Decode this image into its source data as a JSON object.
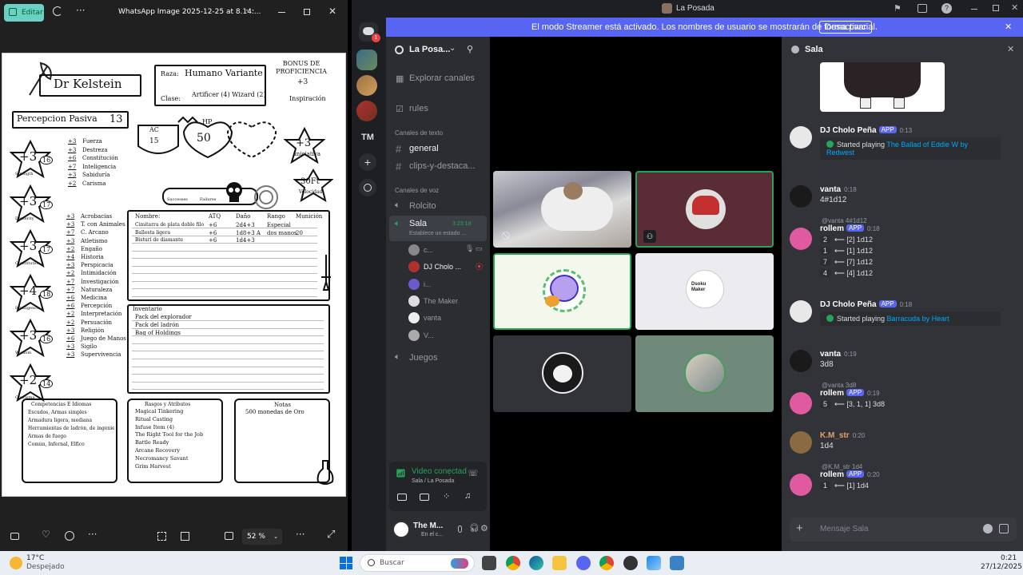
{
  "viewer": {
    "edit_label": "Editar",
    "filename": "WhatsApp Image 2025-12-25 at 8.14....",
    "zoom": "52 %",
    "sheet": {
      "name": "Dr Kelstein",
      "race_label": "Raza:",
      "race": "Humano Variante",
      "class_label": "Clase:",
      "class": "Artificer (4) Wizard (2)",
      "bonus_title": "BONUS DE PROFICIENCIA",
      "bonus": "+3",
      "inspiration": "Inspiración",
      "passive": "Percepcion Pasiva",
      "passive_val": "13",
      "ac_label": "AC",
      "ac": "15",
      "hp_label": "HP",
      "hp": "50",
      "initiative": "+3",
      "initiative_label": "Iniciativa",
      "speed": "30Ft",
      "speed_label": "Velocidad",
      "successes": "Successes",
      "failures": "Failures",
      "saves": [
        {
          "mod": "+3",
          "name": "Fuerza"
        },
        {
          "mod": "+3",
          "name": "Destreza"
        },
        {
          "mod": "+6",
          "name": "Constitución"
        },
        {
          "mod": "+7",
          "name": "Inteligencia"
        },
        {
          "mod": "+3",
          "name": "Sabiduría"
        },
        {
          "mod": "+2",
          "name": "Carisma"
        }
      ],
      "stats": [
        {
          "mod": "+3",
          "score": "16",
          "name": "Strength"
        },
        {
          "mod": "+3",
          "score": "17",
          "name": "Dexterity"
        },
        {
          "mod": "+3",
          "score": "17",
          "name": "Constitution"
        },
        {
          "mod": "+4",
          "score": "18",
          "name": "Intelligence"
        },
        {
          "mod": "+3",
          "score": "16",
          "name": "Wisdom"
        },
        {
          "mod": "+2",
          "score": "14",
          "name": "Charisma"
        }
      ],
      "skills": [
        {
          "mod": "+3",
          "name": "Acrobacias"
        },
        {
          "mod": "+3",
          "name": "T. con Animales"
        },
        {
          "mod": "+7",
          "name": "C. Arcano"
        },
        {
          "mod": "+3",
          "name": "Atletismo"
        },
        {
          "mod": "+2",
          "name": "Engaño"
        },
        {
          "mod": "+4",
          "name": "Historia"
        },
        {
          "mod": "+3",
          "name": "Perspicacia"
        },
        {
          "mod": "+2",
          "name": "Intimidación"
        },
        {
          "mod": "+7",
          "name": "Investigación"
        },
        {
          "mod": "+7",
          "name": "Naturaleza"
        },
        {
          "mod": "+6",
          "name": "Medicina"
        },
        {
          "mod": "+6",
          "name": "Percepción"
        },
        {
          "mod": "+2",
          "name": "Interpretación"
        },
        {
          "mod": "+2",
          "name": "Persuación"
        },
        {
          "mod": "+3",
          "name": "Religión"
        },
        {
          "mod": "+6",
          "name": "Juego de Manos"
        },
        {
          "mod": "+3",
          "name": "Sigilo"
        },
        {
          "mod": "+3",
          "name": "Supervivencia"
        }
      ],
      "attack_headers": [
        "Nombre:",
        "ATQ",
        "Daño",
        "Rango",
        "Munición"
      ],
      "attacks": [
        [
          "Cimitarra de plata doble filo",
          "+6",
          "2d4+3",
          "Especial",
          ""
        ],
        [
          "Ballesta ligera",
          "+6",
          "1d8+3 A",
          "dos manos",
          "20"
        ],
        [
          "Bisturí de diamante",
          "+6",
          "1d4+3",
          "",
          ""
        ]
      ],
      "inventory_title": "Inventario",
      "inventory": [
        "Pack del explorador",
        "Pack del ladrón",
        "Bag of Holdings"
      ],
      "prof_title": "Competencias E Idiomas",
      "prof": [
        "Escudos, Armas simples",
        "Armadura ligera, mediana",
        "Herramientas de ladrón, de ingeniero",
        "Armas de fuego",
        "Común, Infernal, Élfico"
      ],
      "traits_title": "Rasgos y Atributos",
      "traits": [
        "Magical Tinkering",
        "Ritual Casting",
        "Infuse Item (4)",
        "The Right Tool for the Job",
        "Battle Ready",
        "Arcane Recovery",
        "Necromancy Savant",
        "Grim Harvest"
      ],
      "notes_title": "Notas",
      "notes": "500 monedas de Oro"
    }
  },
  "discord": {
    "window_title": "La Posada",
    "banner": "El modo Streamer está activado. Los nombres de usuario se mostrarán de forma parcial.",
    "banner_button": "Desactivar",
    "server_initials": "TM",
    "server_name": "La Posa...",
    "explore": "Explorar canales",
    "rules": "rules",
    "text_cat": "Canales de texto",
    "general": "general",
    "clips": "clips-y-destaca...",
    "voice_cat": "Canales de voz",
    "rolcito": "Rolcito",
    "sala": "Sala",
    "sala_time": "3:23:18",
    "sala_status": "Establece un estado ...",
    "voice_users": [
      "c...",
      "DJ Cholo ...",
      "i...",
      "The Maker",
      "vanta",
      "V..."
    ],
    "juegos": "Juegos",
    "conn_status": "Video conectad",
    "conn_loc": "Sala / La Posada",
    "self_name": "The M...",
    "self_status": "En el c...",
    "maker_tile": "Dsoku Maker",
    "chat_title": "Sala",
    "chat_placeholder": "Mensaje Sala",
    "app_badge": "APP",
    "messages": {
      "m1": {
        "user": "DJ Cholo Peña",
        "time": "0:13",
        "text": "Started playing ",
        "link": "The Ballad of Eddie W by Redwest"
      },
      "m2": {
        "user": "vanta",
        "time": "0:18",
        "text": "4#1d12"
      },
      "m3": {
        "reply": "@vanta 4#1d12",
        "user": "rollem",
        "time": "0:18",
        "rows": [
          [
            "2",
            "⟵ [2] 1d12"
          ],
          [
            "1",
            "⟵ [1] 1d12"
          ],
          [
            "7",
            "⟵ [7] 1d12"
          ],
          [
            "4",
            "⟵ [4] 1d12"
          ]
        ]
      },
      "m4": {
        "user": "DJ Cholo Peña",
        "time": "0:18",
        "text": "Started playing ",
        "link": "Barracuda by Heart"
      },
      "m5": {
        "user": "vanta",
        "time": "0:19",
        "text": "3d8"
      },
      "m6": {
        "reply": "@vanta 3d8",
        "user": "rollem",
        "time": "0:19",
        "rows": [
          [
            "5",
            "⟵ [3, 1, 1] 3d8"
          ]
        ]
      },
      "m7": {
        "user": "K.M_str",
        "time": "0:20",
        "text": "1d4"
      },
      "m8": {
        "reply": "@K.M_str 1d4",
        "user": "rollem",
        "time": "0:20",
        "rows": [
          [
            "1",
            "⟵ [1] 1d4"
          ]
        ]
      }
    }
  },
  "taskbar": {
    "temp": "17°C",
    "weather": "Despejado",
    "search": "Buscar",
    "time": "0:21",
    "date": "27/12/2025"
  }
}
